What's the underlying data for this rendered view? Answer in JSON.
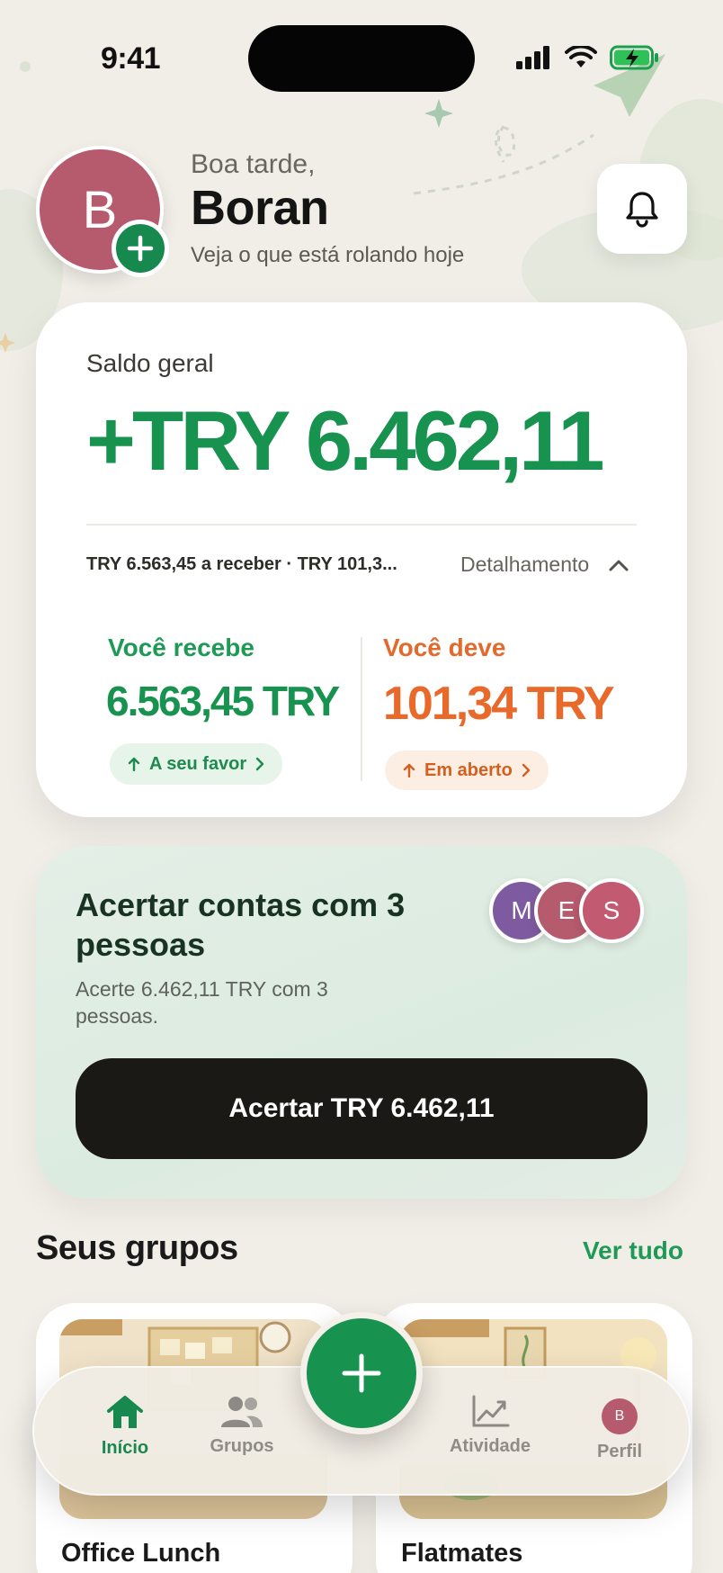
{
  "status_bar": {
    "time": "9:41"
  },
  "header": {
    "avatar_initial": "B",
    "greeting": "Boa tarde,",
    "name": "Boran",
    "subtitle": "Veja o que está rolando hoje"
  },
  "balance": {
    "label": "Saldo geral",
    "amount": "+TRY 6.462,11",
    "summary": "TRY 6.563,45 a receber · TRY 101,3...",
    "detail_label": "Detalhamento",
    "receive": {
      "label": "Você recebe",
      "amount": "6.563,45 TRY",
      "badge": "A seu favor"
    },
    "owe": {
      "label": "Você deve",
      "amount": "101,34 TRY",
      "badge": "Em aberto"
    }
  },
  "settle": {
    "title": "Acertar contas com 3 pessoas",
    "subtitle": "Acerte 6.462,11 TRY com 3 pessoas.",
    "avatars": [
      {
        "initial": "M",
        "color": "#7e5ba0"
      },
      {
        "initial": "E",
        "color": "#b65a6e"
      },
      {
        "initial": "S",
        "color": "#c25a72"
      }
    ],
    "button_label": "Acertar TRY 6.462,11"
  },
  "groups": {
    "title": "Seus grupos",
    "see_all": "Ver tudo",
    "items": [
      {
        "name": "Office Lunch"
      },
      {
        "name": "Flatmates"
      }
    ]
  },
  "tabbar": {
    "items": [
      {
        "label": "Início",
        "icon": "home-icon",
        "active": true
      },
      {
        "label": "Grupos",
        "icon": "people-icon",
        "active": false
      },
      {
        "label": "Atividade",
        "icon": "chart-icon",
        "active": false
      },
      {
        "label": "Perfil",
        "icon": "avatar",
        "active": false
      }
    ],
    "profile_initial": "B"
  },
  "colors": {
    "accent_green": "#17924f",
    "owe_orange": "#e8692a",
    "background": "#f1eee8"
  }
}
